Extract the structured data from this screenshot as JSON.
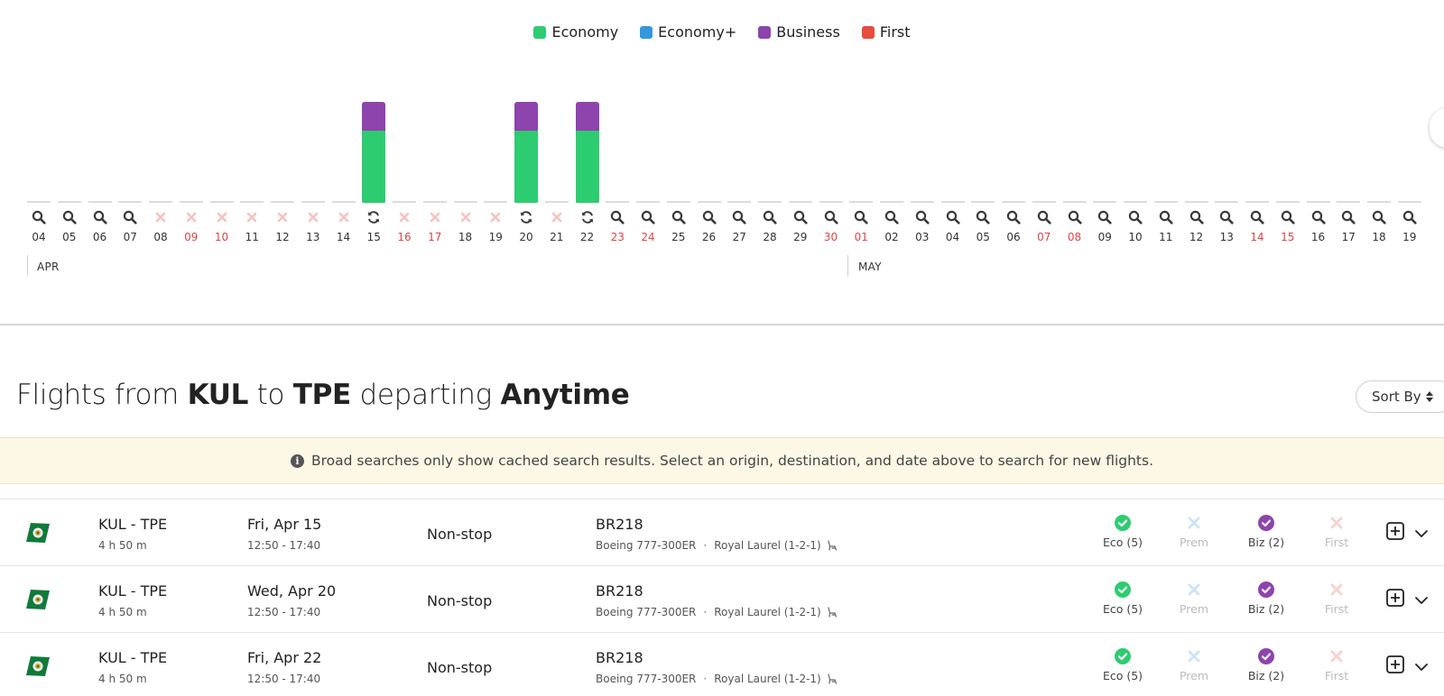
{
  "legend": [
    {
      "label": "Economy",
      "color": "#2ecc71"
    },
    {
      "label": "Economy+",
      "color": "#3498db"
    },
    {
      "label": "Business",
      "color": "#8e44ad"
    },
    {
      "label": "First",
      "color": "#e74c3c"
    }
  ],
  "calendar": {
    "months": [
      "APR",
      "MAY"
    ],
    "days": [
      {
        "label": "04",
        "status": "search",
        "weekend": false
      },
      {
        "label": "05",
        "status": "search",
        "weekend": false
      },
      {
        "label": "06",
        "status": "search",
        "weekend": false
      },
      {
        "label": "07",
        "status": "search",
        "weekend": false
      },
      {
        "label": "08",
        "status": "none",
        "weekend": false
      },
      {
        "label": "09",
        "status": "none",
        "weekend": true
      },
      {
        "label": "10",
        "status": "none",
        "weekend": true
      },
      {
        "label": "11",
        "status": "none",
        "weekend": false
      },
      {
        "label": "12",
        "status": "none",
        "weekend": false
      },
      {
        "label": "13",
        "status": "none",
        "weekend": false
      },
      {
        "label": "14",
        "status": "none",
        "weekend": false
      },
      {
        "label": "15",
        "status": "refresh",
        "weekend": false,
        "eco": 5,
        "biz": 2
      },
      {
        "label": "16",
        "status": "none",
        "weekend": true
      },
      {
        "label": "17",
        "status": "none",
        "weekend": true
      },
      {
        "label": "18",
        "status": "none",
        "weekend": false
      },
      {
        "label": "19",
        "status": "none",
        "weekend": false
      },
      {
        "label": "20",
        "status": "refresh",
        "weekend": false,
        "eco": 5,
        "biz": 2
      },
      {
        "label": "21",
        "status": "none",
        "weekend": false
      },
      {
        "label": "22",
        "status": "refresh",
        "weekend": false,
        "eco": 5,
        "biz": 2
      },
      {
        "label": "23",
        "status": "search",
        "weekend": true
      },
      {
        "label": "24",
        "status": "search",
        "weekend": true
      },
      {
        "label": "25",
        "status": "search",
        "weekend": false
      },
      {
        "label": "26",
        "status": "search",
        "weekend": false
      },
      {
        "label": "27",
        "status": "search",
        "weekend": false
      },
      {
        "label": "28",
        "status": "search",
        "weekend": false
      },
      {
        "label": "29",
        "status": "search",
        "weekend": false
      },
      {
        "label": "30",
        "status": "search",
        "weekend": true
      },
      {
        "label": "01",
        "status": "search",
        "weekend": true
      },
      {
        "label": "02",
        "status": "search",
        "weekend": false
      },
      {
        "label": "03",
        "status": "search",
        "weekend": false
      },
      {
        "label": "04",
        "status": "search",
        "weekend": false
      },
      {
        "label": "05",
        "status": "search",
        "weekend": false
      },
      {
        "label": "06",
        "status": "search",
        "weekend": false
      },
      {
        "label": "07",
        "status": "search",
        "weekend": true
      },
      {
        "label": "08",
        "status": "search",
        "weekend": true
      },
      {
        "label": "09",
        "status": "search",
        "weekend": false
      },
      {
        "label": "10",
        "status": "search",
        "weekend": false
      },
      {
        "label": "11",
        "status": "search",
        "weekend": false
      },
      {
        "label": "12",
        "status": "search",
        "weekend": false
      },
      {
        "label": "13",
        "status": "search",
        "weekend": false
      },
      {
        "label": "14",
        "status": "search",
        "weekend": true
      },
      {
        "label": "15",
        "status": "search",
        "weekend": true
      },
      {
        "label": "16",
        "status": "search",
        "weekend": false
      },
      {
        "label": "17",
        "status": "search",
        "weekend": false
      },
      {
        "label": "18",
        "status": "search",
        "weekend": false
      },
      {
        "label": "19",
        "status": "search",
        "weekend": false
      }
    ]
  },
  "heading": {
    "prefix": "Flights from",
    "origin": "KUL",
    "to": "to",
    "destination": "TPE",
    "departing": "departing",
    "when": "Anytime"
  },
  "sort": {
    "label": "Sort By"
  },
  "notice": {
    "text": "Broad searches only show cached search results. Select an origin, destination, and date above to search for new flights."
  },
  "flights": [
    {
      "route": "KUL - TPE",
      "duration": "4 h 50 m",
      "date": "Fri, Apr 15",
      "times": "12:50 - 17:40",
      "stops": "Non-stop",
      "flight_no": "BR218",
      "aircraft": "Boeing 777-300ER",
      "seat": "Royal Laurel (1-2-1)",
      "cabins": {
        "eco": "Eco (5)",
        "prem": "Prem",
        "biz": "Biz (2)",
        "first": "First"
      }
    },
    {
      "route": "KUL - TPE",
      "duration": "4 h 50 m",
      "date": "Wed, Apr 20",
      "times": "12:50 - 17:40",
      "stops": "Non-stop",
      "flight_no": "BR218",
      "aircraft": "Boeing 777-300ER",
      "seat": "Royal Laurel (1-2-1)",
      "cabins": {
        "eco": "Eco (5)",
        "prem": "Prem",
        "biz": "Biz (2)",
        "first": "First"
      }
    },
    {
      "route": "KUL - TPE",
      "duration": "4 h 50 m",
      "date": "Fri, Apr 22",
      "times": "12:50 - 17:40",
      "stops": "Non-stop",
      "flight_no": "BR218",
      "aircraft": "Boeing 777-300ER",
      "seat": "Royal Laurel (1-2-1)",
      "cabins": {
        "eco": "Eco (5)",
        "prem": "Prem",
        "biz": "Biz (2)",
        "first": "First"
      }
    }
  ]
}
